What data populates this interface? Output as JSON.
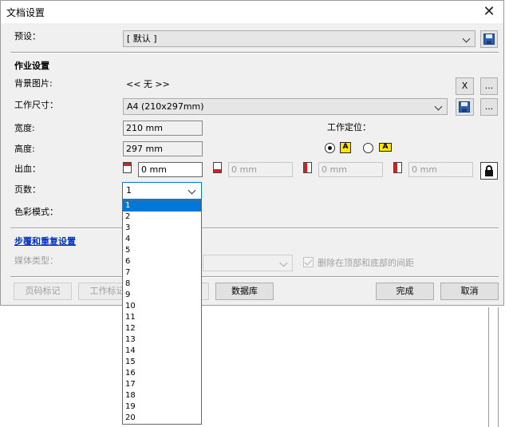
{
  "dialog": {
    "title": "文档设置",
    "preset": {
      "label": "预设：",
      "value": "[ 默认 ]"
    },
    "job_settings": {
      "heading": "作业设置",
      "background_image": {
        "label": "背景图片:",
        "value": "<< 无 >>",
        "clear_label": "X",
        "browse_label": "..."
      },
      "job_size": {
        "label": "工作尺寸：",
        "value": "A4 (210x297mm)",
        "browse_label": "..."
      },
      "width": {
        "label": "宽度:",
        "value": "210 mm"
      },
      "height": {
        "label": "高度:",
        "value": "297 mm"
      },
      "job_position": {
        "label": "工作定位：",
        "option_a": "A",
        "option_b": "A"
      },
      "bleed": {
        "label": "出血：",
        "top": "0 mm",
        "bottom": "0 mm",
        "left": "0 mm",
        "right": "0 mm"
      },
      "pages": {
        "label": "页数：",
        "value": "1",
        "options": [
          "1",
          "2",
          "3",
          "4",
          "5",
          "6",
          "7",
          "8",
          "9",
          "10",
          "11",
          "12",
          "13",
          "14",
          "15",
          "16",
          "17",
          "18",
          "19",
          "20"
        ]
      },
      "color_mode": {
        "label": "色彩模式："
      }
    },
    "step_repeat": {
      "link_label": "步覆和重复设置",
      "media_type_label": "媒体类型：",
      "media_type_value": "",
      "remove_spacing_label": "删除在顶部和底部的间距"
    },
    "footer": {
      "page_marks_label": "页码标记",
      "job_marks_label": "工作标记",
      "database_label": "数据库",
      "finish_label": "完成",
      "cancel_label": "取消"
    }
  },
  "colors": {
    "accent": "#0078d7",
    "bleed_red": "#d81e1e",
    "position_yellow": "#ffe600",
    "link_blue": "#0033cc"
  }
}
